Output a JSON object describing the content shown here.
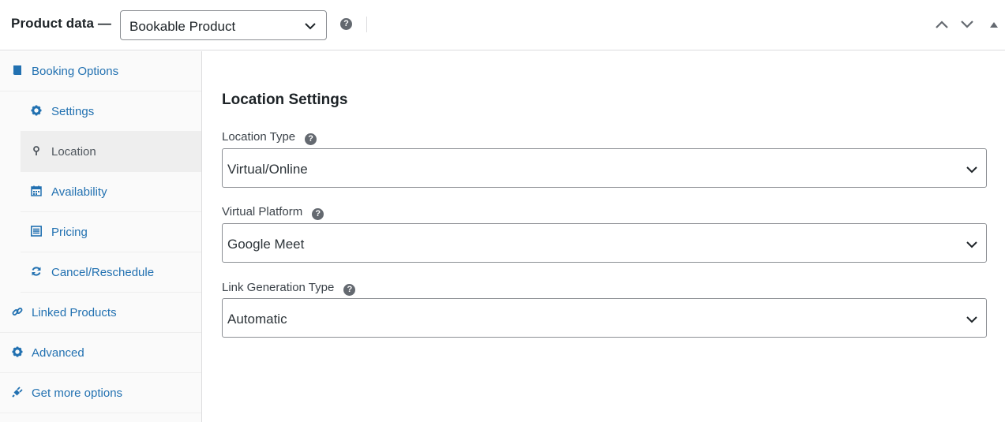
{
  "header": {
    "title": "Product data —",
    "product_type": "Bookable Product",
    "help_icon": "question-circle-icon",
    "move_up_icon": "chevron-up-icon",
    "move_down_icon": "chevron-down-icon",
    "toggle_icon": "triangle-up-icon"
  },
  "sidebar": {
    "items": [
      {
        "label": "Booking Options",
        "icon": "book-icon"
      },
      {
        "label": "Settings",
        "icon": "gear-icon"
      },
      {
        "label": "Location",
        "icon": "map-pin-icon",
        "active": true
      },
      {
        "label": "Availability",
        "icon": "calendar-icon"
      },
      {
        "label": "Pricing",
        "icon": "list-icon"
      },
      {
        "label": "Cancel/Reschedule",
        "icon": "refresh-icon"
      },
      {
        "label": "Linked Products",
        "icon": "link-icon"
      },
      {
        "label": "Advanced",
        "icon": "gear-icon"
      },
      {
        "label": "Get more options",
        "icon": "plugin-icon"
      }
    ]
  },
  "main": {
    "section_title": "Location Settings",
    "fields": [
      {
        "label": "Location Type",
        "value": "Virtual/Online"
      },
      {
        "label": "Virtual Platform",
        "value": "Google Meet"
      },
      {
        "label": "Link Generation Type",
        "value": "Automatic"
      }
    ]
  },
  "colors": {
    "link": "#2271b1",
    "active_bg": "#eeeeee",
    "sidebar_bg": "#fafafa",
    "border": "#8c8f94"
  }
}
